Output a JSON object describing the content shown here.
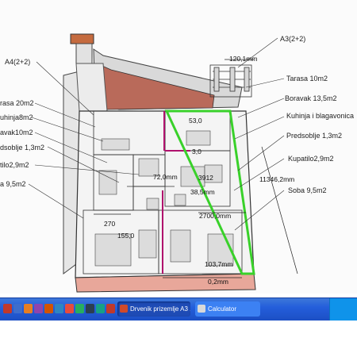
{
  "window": {
    "app": "SketchUp",
    "document_title": "Drvenik prizemlje A3"
  },
  "labels_left": [
    {
      "text": "A4(2+2)"
    },
    {
      "text": "rasa 20m2"
    },
    {
      "text": "uhinja8m2"
    },
    {
      "text": "avak10m2"
    },
    {
      "text": "dsoblje 1,3m2"
    },
    {
      "text": "tilo2,9m2"
    },
    {
      "text": "a 9,5m2"
    }
  ],
  "labels_right": [
    {
      "text": "A3(2+2)"
    },
    {
      "text": "Tarasa 10m2"
    },
    {
      "text": "Boravak 13,5m2"
    },
    {
      "text": "Kuhinja i blagavonica"
    },
    {
      "text": "Predsoblje 1,3m2"
    },
    {
      "text": "Kupatilo2,9m2"
    },
    {
      "text": "Soba 9,5m2"
    }
  ],
  "dimensions": {
    "top": "120,1mm",
    "right": "11346,2mm",
    "mid": "2700,0mm",
    "left_small": "270",
    "inner_1": "53,0",
    "inner_2": "72,0mm",
    "inner_3": "3912",
    "inner_4": "155,0",
    "inner_5": "103,7mm",
    "bottom": "0,2mm",
    "inner_6": "3,0",
    "inner_7": "38,5mm"
  },
  "taskbar": {
    "tasks": [
      {
        "label": "Drvenik prizemlje A3 ...",
        "icon": "sketchup-icon",
        "active": true
      },
      {
        "label": "Calculator",
        "icon": "calculator-icon",
        "active": false
      }
    ],
    "quicklaunch": [
      {
        "icon": "quicklaunch-icon-1",
        "color": "#c0392b"
      },
      {
        "icon": "quicklaunch-icon-2",
        "color": "#3d6dcc"
      },
      {
        "icon": "quicklaunch-icon-3",
        "color": "#e67e22"
      },
      {
        "icon": "quicklaunch-icon-4",
        "color": "#8e44ad"
      },
      {
        "icon": "quicklaunch-icon-5",
        "color": "#d35400"
      },
      {
        "icon": "quicklaunch-icon-6",
        "color": "#2e86c1"
      },
      {
        "icon": "quicklaunch-icon-7",
        "color": "#e74c3c"
      },
      {
        "icon": "quicklaunch-icon-8",
        "color": "#27ae60"
      },
      {
        "icon": "quicklaunch-icon-9",
        "color": "#2c3e50"
      },
      {
        "icon": "quicklaunch-icon-10",
        "color": "#16a085"
      },
      {
        "icon": "quicklaunch-icon-11",
        "color": "#c0392b"
      }
    ]
  },
  "colors": {
    "taskbar": "#245edb",
    "roof": "#b96a5a",
    "highlight_green": "#39d12a",
    "partition_magenta": "#b0116d",
    "floor_salmon": "#e8a79a"
  }
}
